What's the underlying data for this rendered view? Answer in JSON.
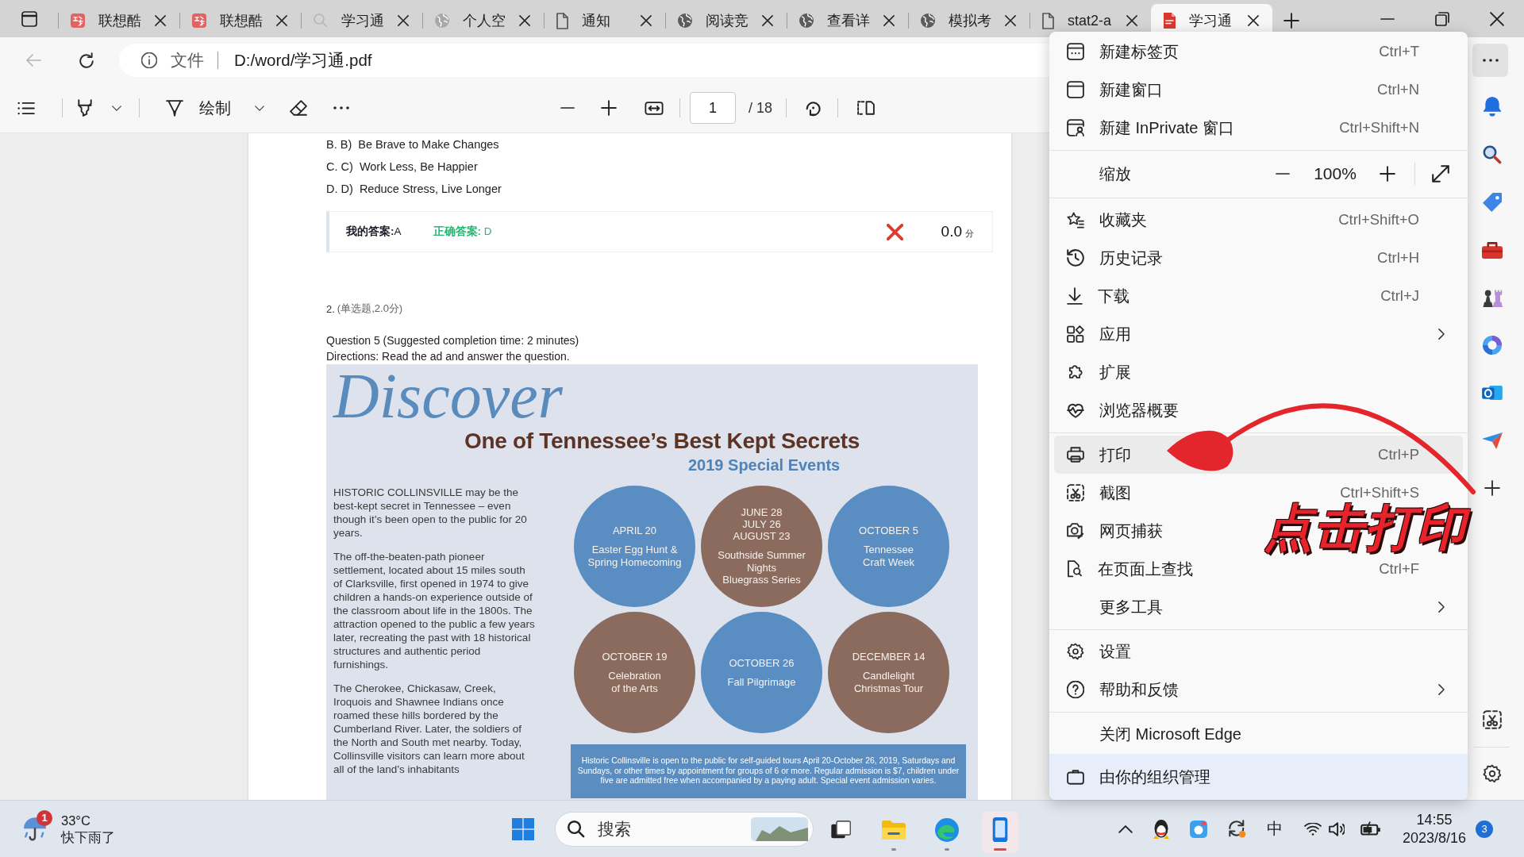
{
  "tabs": [
    {
      "title": "联想酷",
      "selected": false
    },
    {
      "title": "联想酷",
      "selected": false
    },
    {
      "title": "学习通",
      "selected": false
    },
    {
      "title": "个人空",
      "selected": false
    },
    {
      "title": "通知",
      "selected": false
    },
    {
      "title": "阅读竞",
      "selected": false
    },
    {
      "title": "查看详",
      "selected": false
    },
    {
      "title": "模拟考",
      "selected": false
    },
    {
      "title": "stat2-a",
      "selected": false
    },
    {
      "title": "学习通",
      "selected": true
    }
  ],
  "address_bar": {
    "scheme": "文件",
    "url": "D:/word/学习通.pdf"
  },
  "pdf_toolbar": {
    "draw_label": "绘制",
    "page": "1",
    "page_count": "/ 18"
  },
  "document": {
    "options": [
      "B. B)  Be Brave to Make Changes",
      "C. C)  Work Less, Be Happier",
      "D. D)  Reduce Stress, Live Longer"
    ],
    "result": {
      "my_answer": "**我的答案:**A",
      "correct_answer": "**正确答案:** D",
      "correct": false,
      "score": "0.0",
      "score_unit": "分"
    },
    "question_number": "2.",
    "question_type": "(单选题,2.0分)",
    "question_text": [
      "Question 5 (Suggested completion time: 2 minutes)",
      "Directions: Read the ad and answer the question."
    ],
    "ad": {
      "script_title": "Discover",
      "headline": "One of Tennessee’s Best Kept Secrets",
      "subheadline": "2019 Special Events",
      "paragraphs": [
        "HISTORIC COLLINSVILLE may be the best-kept secret in Tennessee – even though it’s been open to the public for 20 years.",
        "The off-the-beaten-path pioneer settlement, located about 15 miles south of Clarksville, first opened in 1974 to give children a hands-on experience outside of the classroom about life in the 1800s. The attraction opened to the public a few years later, recreating the past with 18 historical structures and authentic period furnishings.",
        "The Cherokee, Chickasaw, Creek, Iroquois and Shawnee Indians once roamed these hills bordered by the Cumberland River. Later, the soldiers of the North and South met nearby. Today, Collinsville visitors can learn more about all of the land’s inhabitants"
      ],
      "events": [
        {
          "dates": [
            "APRIL 20"
          ],
          "title": [
            "Easter Egg Hunt &",
            "Spring Homecoming"
          ],
          "color": "#5a8ec2"
        },
        {
          "dates": [
            "JUNE 28",
            "JULY 26",
            "AUGUST 23"
          ],
          "title": [
            "Southside Summer",
            "Nights",
            "Bluegrass Series"
          ],
          "color": "#8b6b5e"
        },
        {
          "dates": [
            "OCTOBER 5"
          ],
          "title": [
            "Tennessee",
            "Craft Week"
          ],
          "color": "#5a8ec2"
        },
        {
          "dates": [
            "OCTOBER 19"
          ],
          "title": [
            "Celebration",
            "of the Arts"
          ],
          "color": "#8b6b5e"
        },
        {
          "dates": [
            "OCTOBER 26"
          ],
          "title": [
            "Fall Pilgrimage"
          ],
          "color": "#5a8ec2"
        },
        {
          "dates": [
            "DECEMBER 14"
          ],
          "title": [
            "Candlelight",
            "Christmas Tour"
          ],
          "color": "#8b6b5e"
        }
      ],
      "notice": "Historic Collinsville is open to the public for self-guided tours April 20-October 26, 2019, Saturdays and Sundays, or other times by appointment for groups of 6 or more. Regular admission is $7, children under five are admitted free when accompanied by a paying adult. Special event admission varies."
    }
  },
  "menu": {
    "groups": [
      [
        {
          "kind": "command",
          "label": "新建标签页",
          "shortcut": "Ctrl+T",
          "highlighted": false
        },
        {
          "kind": "command",
          "label": "新建窗口",
          "shortcut": "Ctrl+N",
          "highlighted": false
        },
        {
          "kind": "command",
          "label": "新建 InPrivate 窗口",
          "shortcut": "Ctrl+Shift+N",
          "highlighted": false
        }
      ],
      [
        {
          "kind": "zoom",
          "label": "缩放",
          "value": "100%"
        }
      ],
      [
        {
          "kind": "command",
          "label": "收藏夹",
          "shortcut": "Ctrl+Shift+O",
          "highlighted": false
        },
        {
          "kind": "command",
          "label": "历史记录",
          "shortcut": "Ctrl+H",
          "highlighted": false
        },
        {
          "kind": "command",
          "label": "下载",
          "shortcut": "Ctrl+J",
          "highlighted": false
        },
        {
          "kind": "submenu",
          "label": "应用",
          "highlighted": false
        },
        {
          "kind": "command",
          "label": "扩展",
          "highlighted": false
        },
        {
          "kind": "command",
          "label": "浏览器概要",
          "highlighted": false
        }
      ],
      [
        {
          "kind": "command",
          "label": "打印",
          "shortcut": "Ctrl+P",
          "highlighted": true
        },
        {
          "kind": "command",
          "label": "截图",
          "shortcut": "Ctrl+Shift+S",
          "highlighted": false
        },
        {
          "kind": "command",
          "label": "网页捕获",
          "highlighted": false
        },
        {
          "kind": "command",
          "label": "在页面上查找",
          "shortcut": "Ctrl+F",
          "highlighted": false
        },
        {
          "kind": "submenu",
          "label": "更多工具",
          "highlighted": false
        }
      ],
      [
        {
          "kind": "command",
          "label": "设置",
          "highlighted": false
        },
        {
          "kind": "submenu",
          "label": "帮助和反馈",
          "highlighted": false
        }
      ],
      [
        {
          "kind": "command",
          "label": "关闭 Microsoft Edge",
          "highlighted": false
        }
      ]
    ],
    "managed_notice": "由你的组织管理"
  },
  "annotation": {
    "text": "点击打印"
  },
  "taskbar": {
    "weather": {
      "temperature": "33°C",
      "condition": "快下雨了",
      "badge": "1"
    },
    "search_placeholder": "搜索",
    "apps": [
      {
        "running": false,
        "focused": false
      },
      {
        "running": true,
        "focused": false
      },
      {
        "running": true,
        "focused": false
      },
      {
        "running": true,
        "focused": true
      }
    ],
    "input_method": "中",
    "time": "14:55",
    "date": "2023/8/16",
    "notifications": "3"
  }
}
